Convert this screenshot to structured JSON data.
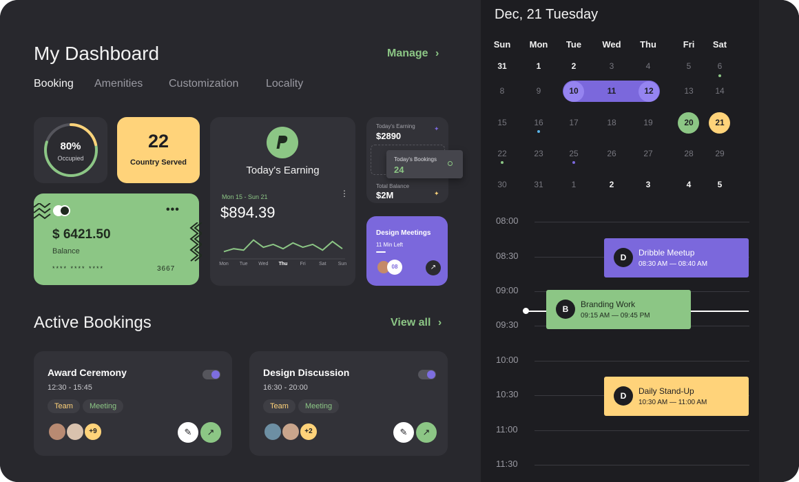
{
  "header": {
    "title": "My Dashboard",
    "manage_label": "Manage"
  },
  "tabs": [
    {
      "label": "Booking",
      "active": true
    },
    {
      "label": "Amenities"
    },
    {
      "label": "Customization"
    },
    {
      "label": "Locality"
    }
  ],
  "occupancy": {
    "percent_label": "80%",
    "caption": "Occupied",
    "value": 0.8
  },
  "country": {
    "value": "22",
    "caption": "Country Served"
  },
  "balance_card": {
    "amount": "$ 6421.50",
    "caption": "Balance",
    "card_masked": "**** **** ****",
    "card_last": "3667"
  },
  "earning": {
    "title": "Today's Earning",
    "range": "Mon 15 - Sun 21",
    "amount": "$894.39",
    "days": [
      "Mon",
      "Tue",
      "Wed",
      "Thu",
      "Fri",
      "Sat",
      "Sun"
    ],
    "active_day": "Thu"
  },
  "chart_data": {
    "type": "line",
    "title": "",
    "xlabel": "",
    "ylabel": "",
    "categories": [
      "Mon",
      "Tue",
      "Wed",
      "Thu",
      "Fri",
      "Sat",
      "Sun"
    ],
    "x": [
      0,
      0.5,
      1,
      1.5,
      2,
      2.5,
      3,
      3.5,
      4,
      4.5,
      5,
      5.5,
      6
    ],
    "values": [
      3,
      4,
      3.5,
      7,
      4.5,
      5.5,
      4,
      6,
      4.5,
      5.5,
      3.5,
      6.5,
      4
    ],
    "ylim": [
      0,
      10
    ],
    "grid": false
  },
  "stats": {
    "today_earning_label": "Today's Earning",
    "today_earning_value": "$2890",
    "today_bookings_label": "Today's Bookings",
    "today_bookings_value": "24",
    "total_balance_label": "Total Balance",
    "total_balance_value": "$2M"
  },
  "meeting": {
    "title": "Design Meetings",
    "subtitle": "11 Min Left",
    "badge": "08"
  },
  "active_bookings": {
    "title": "Active Bookings",
    "view_all": "View all",
    "items": [
      {
        "title": "Award Ceremony",
        "time": "12:30 - 15:45",
        "tags": [
          "Team",
          "Meeting"
        ],
        "more": "+9"
      },
      {
        "title": "Design Discussion",
        "time": "16:30 - 20:00",
        "tags": [
          "Team",
          "Meeting"
        ],
        "more": "+2"
      }
    ]
  },
  "calendar": {
    "date_title": "Dec, 21 Tuesday",
    "weekdays": [
      "Sun",
      "Mon",
      "Tue",
      "Wed",
      "Thu",
      "Fri",
      "Sat"
    ],
    "weeks": [
      [
        "31",
        "1",
        "2",
        "3",
        "4",
        "5",
        "6"
      ],
      [
        "8",
        "9",
        "10",
        "11",
        "12",
        "13",
        "14"
      ],
      [
        "15",
        "16",
        "17",
        "18",
        "19",
        "20",
        "21"
      ],
      [
        "22",
        "23",
        "25",
        "26",
        "27",
        "28",
        "29"
      ],
      [
        "30",
        "31",
        "1",
        "2",
        "3",
        "4",
        "5"
      ]
    ]
  },
  "schedule": {
    "times": [
      "08:00",
      "08:30",
      "09:00",
      "09:30",
      "10:00",
      "10:30",
      "11:00",
      "11:30"
    ],
    "events": [
      {
        "initial": "D",
        "title": "Dribble Meetup",
        "time": "08:30 AM — 08:40 AM",
        "color": "#7b68dc"
      },
      {
        "initial": "B",
        "title": "Branding Work",
        "time": "09:15 AM — 09:45 PM",
        "color": "#8cc685"
      },
      {
        "initial": "D",
        "title": "Daily Stand-Up",
        "time": "10:30 AM — 11:00 AM",
        "color": "#ffd37a"
      }
    ]
  },
  "colors": {
    "accent_purple": "#7b68dc",
    "accent_green": "#8cc685",
    "accent_yellow": "#ffd37a",
    "background": "#28282d",
    "card": "#323238"
  }
}
